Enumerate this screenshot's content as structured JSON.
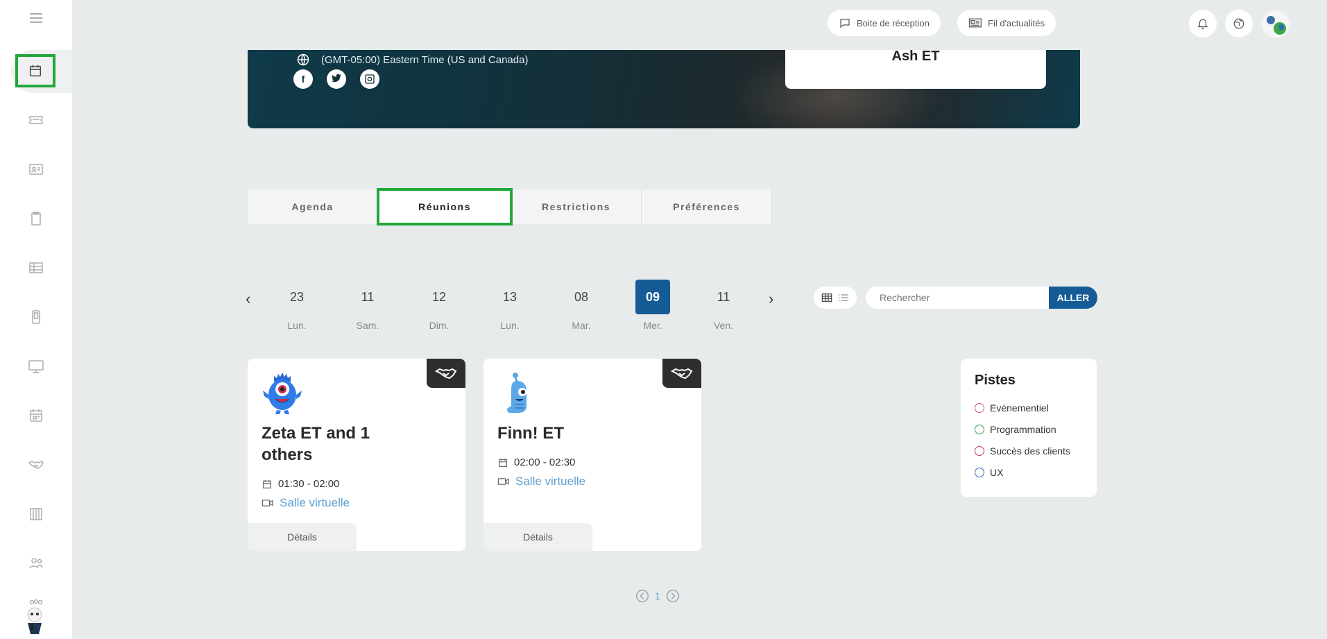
{
  "header": {
    "inbox_label": "Boite de réception",
    "feed_label": "Fil d'actualités"
  },
  "sidebar": {
    "items": [
      "menu-icon",
      "calendar-icon",
      "ticket-icon",
      "id-card-icon",
      "clipboard-icon",
      "table-icon",
      "mobile-icon",
      "monitor-icon",
      "calendar-grid-icon",
      "handshake-icon",
      "booth-icon",
      "users-icon"
    ]
  },
  "banner": {
    "timezone": "(GMT-05:00) Eastern Time (US and Canada)",
    "profile_name": "Ash ET",
    "social": [
      "facebook",
      "twitter",
      "instagram"
    ]
  },
  "tabs": [
    {
      "label": "Agenda"
    },
    {
      "label": "Réunions"
    },
    {
      "label": "Restrictions"
    },
    {
      "label": "Préférences"
    }
  ],
  "dates": [
    {
      "num": "23",
      "day": "Lun."
    },
    {
      "num": "11",
      "day": "Sam."
    },
    {
      "num": "12",
      "day": "Dim."
    },
    {
      "num": "13",
      "day": "Lun."
    },
    {
      "num": "08",
      "day": "Mar."
    },
    {
      "num": "09",
      "day": "Mer."
    },
    {
      "num": "11",
      "day": "Ven."
    }
  ],
  "selected_date_index": 5,
  "search": {
    "placeholder": "Rechercher",
    "button_label": "ALLER"
  },
  "meetings": [
    {
      "title": "Zeta ET and 1 others",
      "time": "01:30 - 02:00",
      "room": "Salle virtuelle",
      "details_label": "Détails"
    },
    {
      "title": "Finn! ET",
      "time": "02:00 - 02:30",
      "room": "Salle virtuelle",
      "details_label": "Détails"
    }
  ],
  "tracks": {
    "title": "Pistes",
    "items": [
      {
        "label": "Evénementiel",
        "color": "#d2567a"
      },
      {
        "label": "Programmation",
        "color": "#3e9c4b"
      },
      {
        "label": "Succès des clients",
        "color": "#cc3a5f"
      },
      {
        "label": "UX",
        "color": "#2f5fbf"
      }
    ]
  },
  "pagination": {
    "current_page": "1"
  },
  "colors": {
    "accent": "#155c96",
    "highlight": "#22a83c",
    "link": "#5fa1d3"
  }
}
